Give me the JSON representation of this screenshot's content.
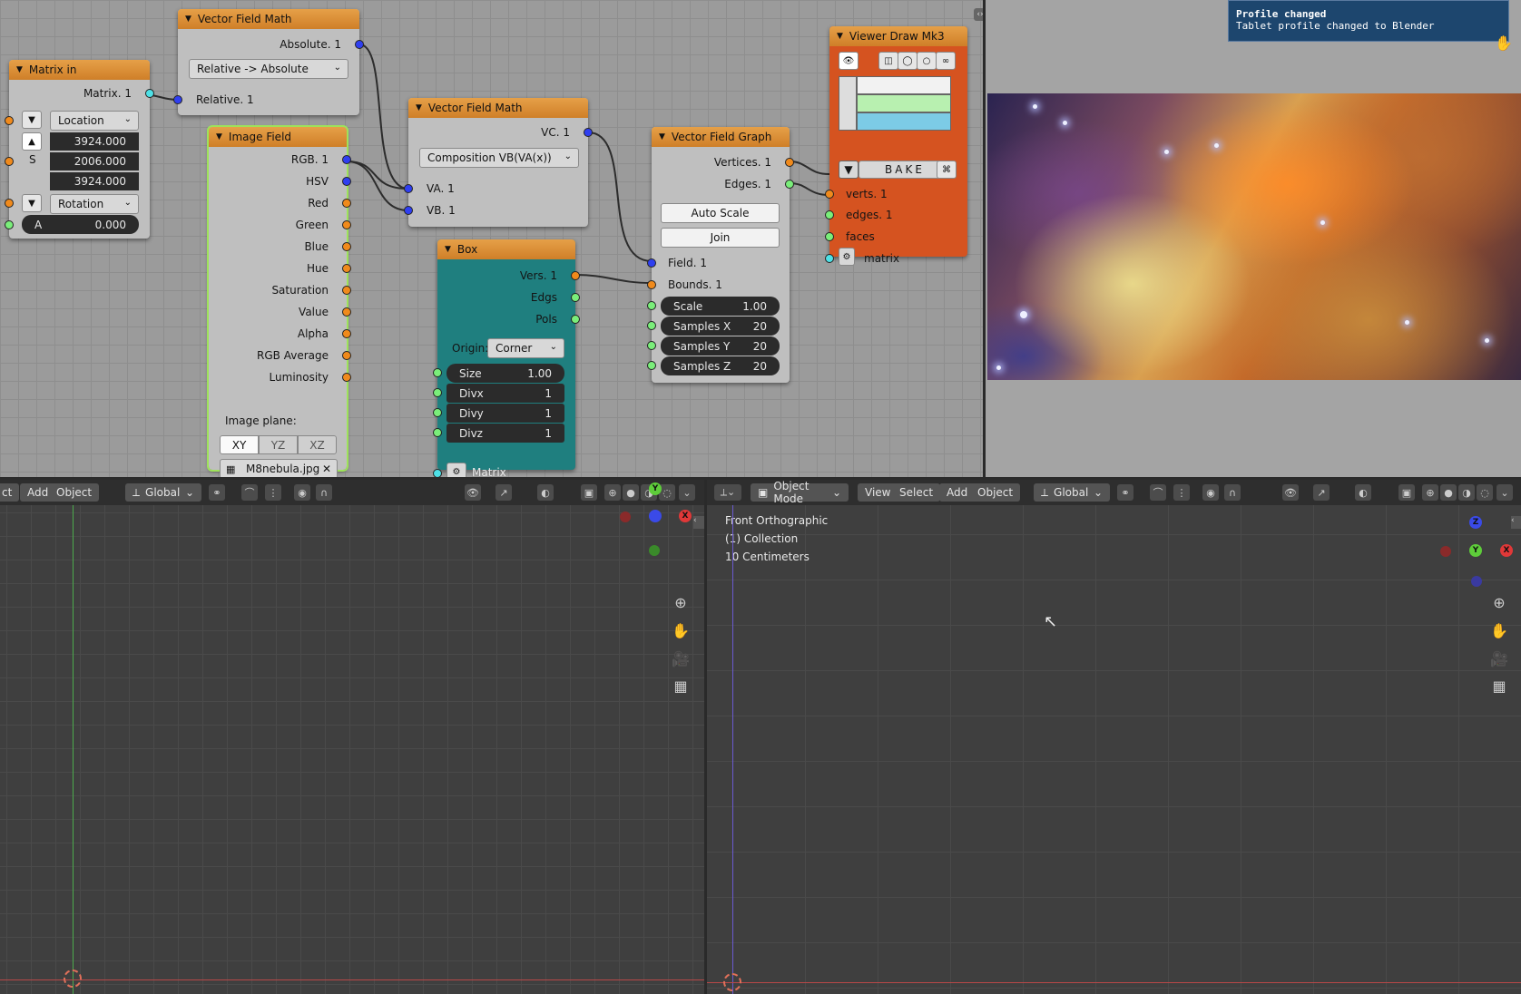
{
  "toast": {
    "title": "Profile changed",
    "message": "Tablet profile changed to Blender"
  },
  "nodes": {
    "matrix_in": {
      "title": "Matrix in",
      "output": "Matrix. 1",
      "location_label": "Location",
      "loc_values": [
        "3924.000",
        "2006.000",
        "3924.000"
      ],
      "s_label": "S",
      "rotation_label": "Rotation",
      "a_label": "A",
      "a_value": "0.000"
    },
    "vfm1": {
      "title": "Vector Field Math",
      "output": "Absolute. 1",
      "mode": "Relative -> Absolute",
      "input": "Relative. 1"
    },
    "image_field": {
      "title": "Image Field",
      "outputs": [
        "RGB. 1",
        "HSV",
        "Red",
        "Green",
        "Blue",
        "Hue",
        "Saturation",
        "Value",
        "Alpha",
        "RGB Average",
        "Luminosity"
      ],
      "plane_label": "Image plane:",
      "planes": [
        "XY",
        "YZ",
        "XZ"
      ],
      "image_name": "M8nebula.jpg"
    },
    "vfm2": {
      "title": "Vector Field Math",
      "output": "VC. 1",
      "mode": "Composition VB(VA(x))",
      "inputs": [
        "VA. 1",
        "VB. 1"
      ]
    },
    "box": {
      "title": "Box",
      "outputs": [
        "Vers. 1",
        "Edgs",
        "Pols"
      ],
      "origin_label": "Origin:",
      "origin_value": "Corner",
      "fields": [
        {
          "label": "Size",
          "value": "1.00"
        },
        {
          "label": "Divx",
          "value": "1"
        },
        {
          "label": "Divy",
          "value": "1"
        },
        {
          "label": "Divz",
          "value": "1"
        }
      ],
      "matrix_label": "Matrix"
    },
    "vfg": {
      "title": "Vector Field Graph",
      "outputs": [
        "Vertices. 1",
        "Edges. 1"
      ],
      "auto_scale": "Auto Scale",
      "join": "Join",
      "inputs": [
        "Field. 1",
        "Bounds. 1"
      ],
      "fields": [
        {
          "label": "Scale",
          "value": "1.00"
        },
        {
          "label": "Samples X",
          "value": "20"
        },
        {
          "label": "Samples Y",
          "value": "20"
        },
        {
          "label": "Samples Z",
          "value": "20"
        }
      ]
    },
    "viewer": {
      "title": "Viewer Draw Mk3",
      "bake": "BAKE",
      "inputs": [
        "verts. 1",
        "edges. 1",
        "faces",
        "matrix"
      ],
      "swatch_colors": [
        "#f2f2f2",
        "#b8f0b0",
        "#7ccbe6"
      ]
    }
  },
  "left_viewport": {
    "header": {
      "btn_partial": "ct",
      "add": "Add",
      "object": "Object",
      "orientation": "Global"
    }
  },
  "right_viewport": {
    "header": {
      "mode": "Object Mode",
      "view": "View",
      "select": "Select",
      "add": "Add",
      "object": "Object",
      "orientation": "Global"
    },
    "overlay": {
      "view_name": "Front Orthographic",
      "collection": "(1) Collection",
      "scale": "10 Centimeters"
    }
  },
  "colors": {
    "node_header": "#d98a30",
    "box_body": "#1f7f7f",
    "viewer_body": "#d55320",
    "arrow": "#86f086"
  }
}
